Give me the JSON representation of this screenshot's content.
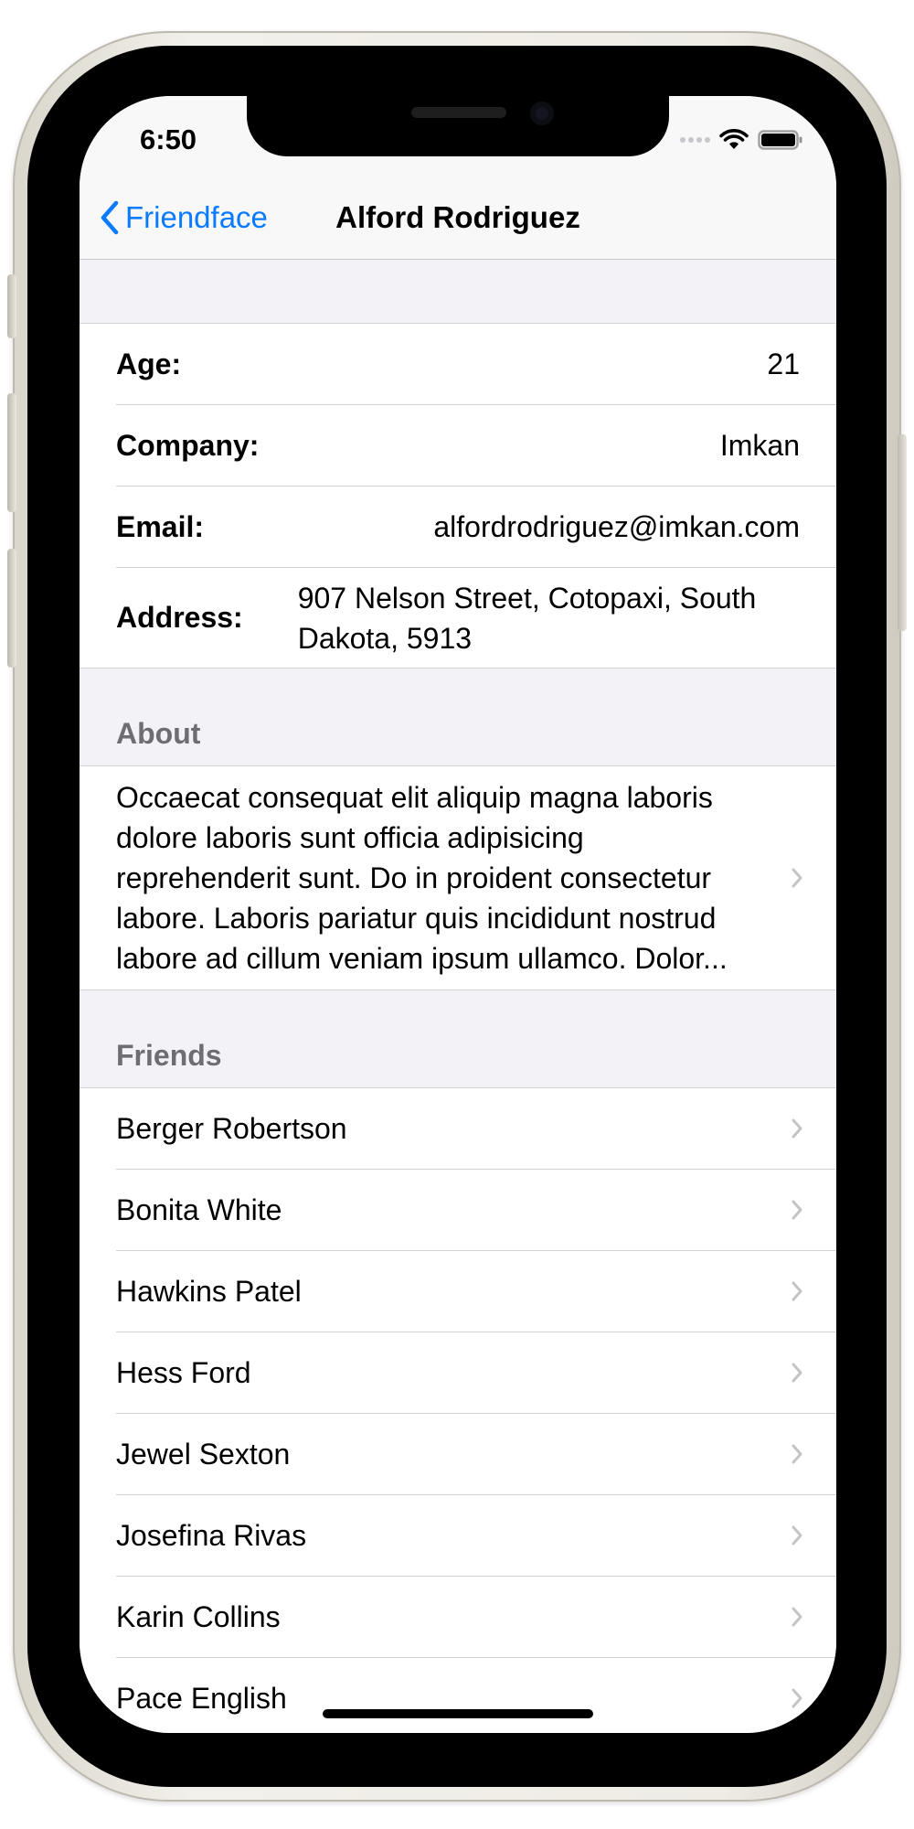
{
  "status_bar": {
    "time": "6:50"
  },
  "nav": {
    "back_label": "Friendface",
    "title": "Alford Rodriguez"
  },
  "details": {
    "age": {
      "label": "Age:",
      "value": "21"
    },
    "company": {
      "label": "Company:",
      "value": "Imkan"
    },
    "email": {
      "label": "Email:",
      "value": "alfordrodriguez@imkan.com"
    },
    "address": {
      "label": "Address:",
      "value": "907 Nelson Street, Cotopaxi, South Dakota, 5913"
    }
  },
  "about": {
    "header": "About",
    "text": "Occaecat consequat elit aliquip magna laboris dolore laboris sunt officia adipisicing reprehenderit sunt. Do in proident consectetur labore. Laboris pariatur quis incididunt nostrud labore ad cillum veniam ipsum ullamco. Dolor..."
  },
  "friends": {
    "header": "Friends",
    "items": [
      "Berger Robertson",
      "Bonita White",
      "Hawkins Patel",
      "Hess Ford",
      "Jewel Sexton",
      "Josefina Rivas",
      "Karin Collins",
      "Pace English"
    ]
  },
  "colors": {
    "accent": "#0a7aff",
    "grouped_background": "#f2f2f7",
    "separator": "#d1d1d6",
    "section_header_text": "#6d6d72"
  }
}
